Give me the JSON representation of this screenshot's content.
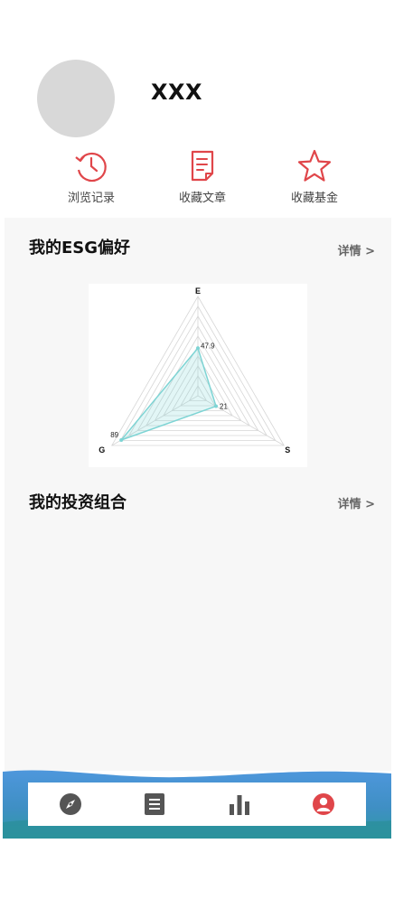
{
  "profile": {
    "username": "XXX"
  },
  "quick_actions": [
    {
      "label": "浏览记录",
      "icon": "history-clock-icon"
    },
    {
      "label": "收藏文章",
      "icon": "document-icon"
    },
    {
      "label": "收藏基金",
      "icon": "star-icon"
    }
  ],
  "esg_section": {
    "title": "我的ESG偏好",
    "more": "详情 >"
  },
  "portfolio_section": {
    "title": "我的投资组合",
    "more": "详情 >"
  },
  "chart_data": {
    "type": "radar",
    "categories": [
      "E",
      "S",
      "G"
    ],
    "values": [
      47.9,
      21,
      89
    ],
    "value_labels": [
      "47.9",
      "21",
      "89"
    ],
    "max": 100,
    "grid_levels": 10,
    "color": "#7dd4d4"
  },
  "bottom_nav": [
    {
      "icon": "compass-icon",
      "active": false
    },
    {
      "icon": "list-icon",
      "active": false
    },
    {
      "icon": "bar-chart-icon",
      "active": false
    },
    {
      "icon": "user-profile-icon",
      "active": true
    }
  ],
  "colors": {
    "accent": "#e0464a",
    "nav_inactive": "#555555",
    "wave_top": "#4e97dc",
    "wave_bottom": "#2e9aa4"
  }
}
